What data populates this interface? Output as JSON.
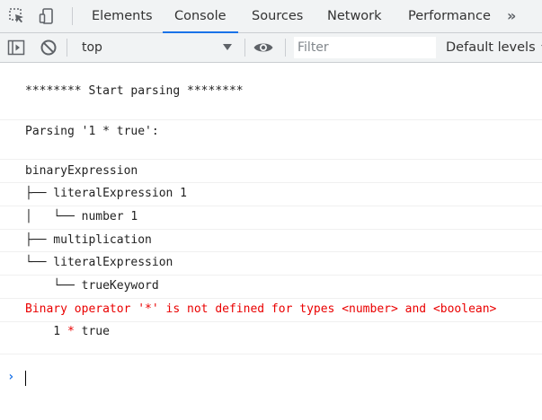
{
  "tabs": [
    {
      "label": "Elements"
    },
    {
      "label": "Console"
    },
    {
      "label": "Sources"
    },
    {
      "label": "Network"
    },
    {
      "label": "Performance"
    }
  ],
  "active_tab": "Console",
  "more_tabs_glyph": "»",
  "toolbar": {
    "context": "top",
    "filter_placeholder": "Filter",
    "levels_label": "Default levels"
  },
  "console": {
    "start_line": "******** Start parsing ********",
    "parsing_line": "Parsing '1 * true':",
    "tree": [
      "binaryExpression",
      "├── literalExpression 1",
      "│   └── number 1",
      "├── multiplication",
      "└── literalExpression",
      "    └── trueKeyword"
    ],
    "error_line": "Binary operator '*' is not defined for types <number> and <boolean>",
    "source_left": "    1 ",
    "source_op": "*",
    "source_right": " true"
  },
  "prompt_glyph": "›",
  "colors": {
    "accent": "#1a73e8",
    "error": "#ea0000",
    "toolbar_bg": "#f1f3f4"
  }
}
